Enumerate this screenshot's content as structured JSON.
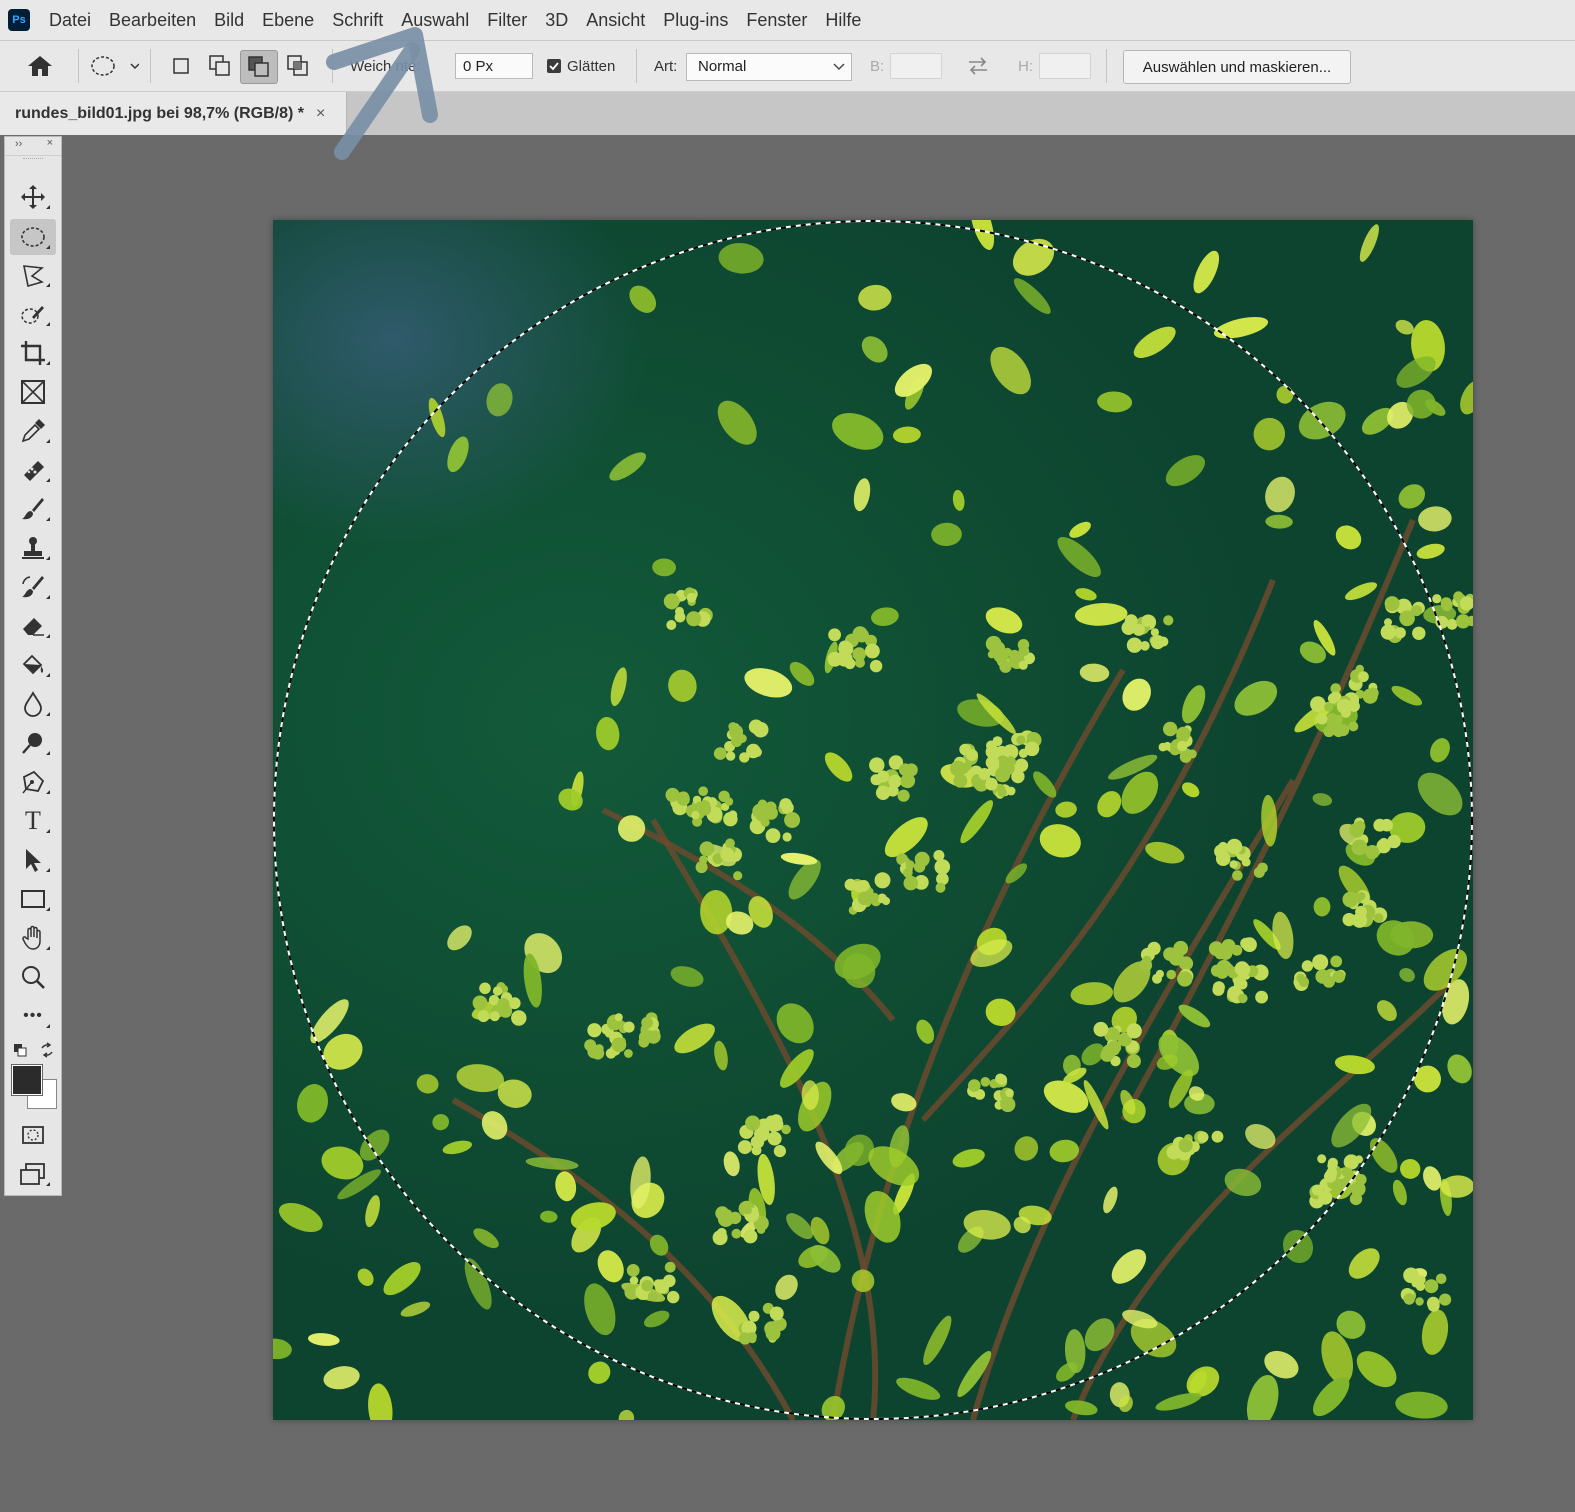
{
  "app": {
    "logo": "Ps"
  },
  "menu": [
    "Datei",
    "Bearbeiten",
    "Bild",
    "Ebene",
    "Schrift",
    "Auswahl",
    "Filter",
    "3D",
    "Ansicht",
    "Plug-ins",
    "Fenster",
    "Hilfe"
  ],
  "options": {
    "feather_label": "Weichzeichnen:",
    "feather_label_visible": "Weich    nte:",
    "feather_value": "0 Px",
    "antialias_label": "Glätten",
    "style_label": "Art:",
    "style_value": "Normal",
    "width_label": "B:",
    "height_label": "H:",
    "mask_button": "Auswählen und maskieren..."
  },
  "document": {
    "tab_title": "rundes_bild01.jpg bei 98,7% (RGB/8) *",
    "close": "×"
  },
  "toolbar": {
    "expand": "››",
    "close": "×",
    "tools": [
      "move-tool",
      "elliptical-marquee-tool",
      "lasso-tool",
      "quick-selection-tool",
      "crop-tool",
      "frame-tool",
      "eyedropper-tool",
      "healing-brush-tool",
      "brush-tool",
      "clone-stamp-tool",
      "history-brush-tool",
      "eraser-tool",
      "paint-bucket-tool",
      "blur-tool",
      "dodge-tool",
      "pen-tool",
      "type-tool",
      "path-selection-tool",
      "rectangle-tool",
      "hand-tool",
      "zoom-tool",
      "more-tools"
    ],
    "active_tool": "elliptical-marquee-tool",
    "type_glyph": "T",
    "more_glyph": "•••"
  },
  "colors": {
    "foreground": "#2b2b2b",
    "background": "#ffffff",
    "arrow": "#7a8fa6"
  }
}
